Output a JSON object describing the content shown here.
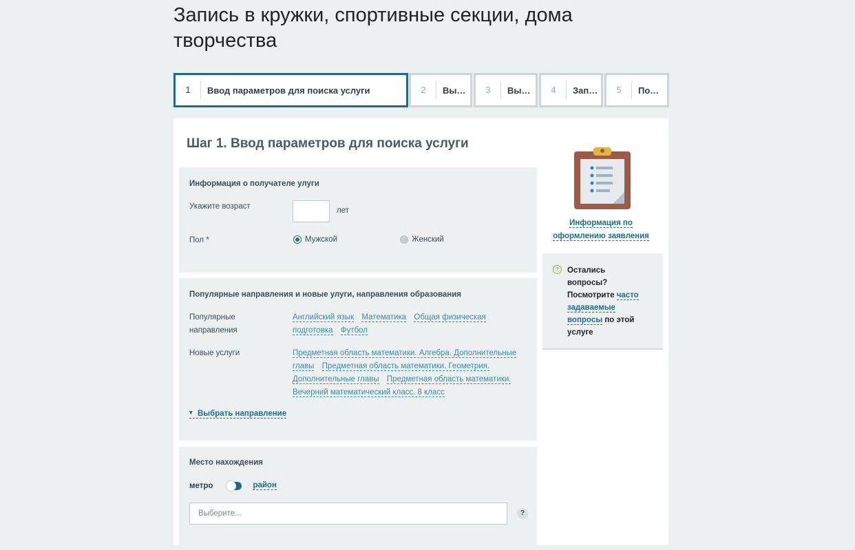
{
  "page": {
    "title": "Запись в кружки, спортивные секции, дома творчества"
  },
  "stepper": {
    "steps": [
      {
        "num": "1",
        "label": "Ввод параметров для поиска услуги"
      },
      {
        "num": "2",
        "label": "Выб…"
      },
      {
        "num": "3",
        "label": "Выб…"
      },
      {
        "num": "4",
        "label": "Зап…"
      },
      {
        "num": "5",
        "label": "Под…"
      }
    ]
  },
  "main": {
    "step_heading": "Шаг 1. Ввод параметров для поиска услуги",
    "recipient": {
      "title": "Информация о получателе улуги",
      "age_label": "Укажите возраст",
      "age_value": "",
      "age_unit": "лет",
      "gender_label": "Пол *",
      "gender_male": "Мужской",
      "gender_female": "Женский",
      "gender_selected": "male"
    },
    "popular": {
      "title": "Популярные направления и новые улуги, направления образования",
      "popular_label_1": "Популярные",
      "popular_label_2": "направления",
      "popular_links": [
        "Английский язык",
        "Математика",
        "Общая физическая подготовка",
        "Футбол"
      ],
      "new_label": "Новые услуги",
      "new_links": [
        "Предметная область математики. Алгебра. Дополнительные главы",
        "Предметная область математики. Геометрия. Дополнительные главы",
        "Предметная область математики. Вечерний математический класс. 8 класс"
      ],
      "choose_direction": "Выбрать направление"
    },
    "location": {
      "title": "Мecто нахождения",
      "toggle_left": "метро",
      "toggle_right": "район",
      "select_placeholder": "Выберите...",
      "help_icon": "?"
    }
  },
  "sidebar": {
    "clipboard_icon": "clipboard-icon",
    "info_link_1": "Информация по",
    "info_link_2": "оформлению заявления",
    "faq": {
      "icon": "?",
      "text_1": "Оcталиcь",
      "text_2": "вопроcы?",
      "text_3": "Поcмотрите ",
      "link_1": "чаcто",
      "link_2": "задаваемые",
      "link_3": "вопроcы",
      "text_4": " по этой",
      "text_5": "уcлуге"
    }
  },
  "colors": {
    "accent": "#1d6b86",
    "link": "#3a8aa6",
    "background": "#edf0f1",
    "faq_icon": "#8fb43a"
  }
}
